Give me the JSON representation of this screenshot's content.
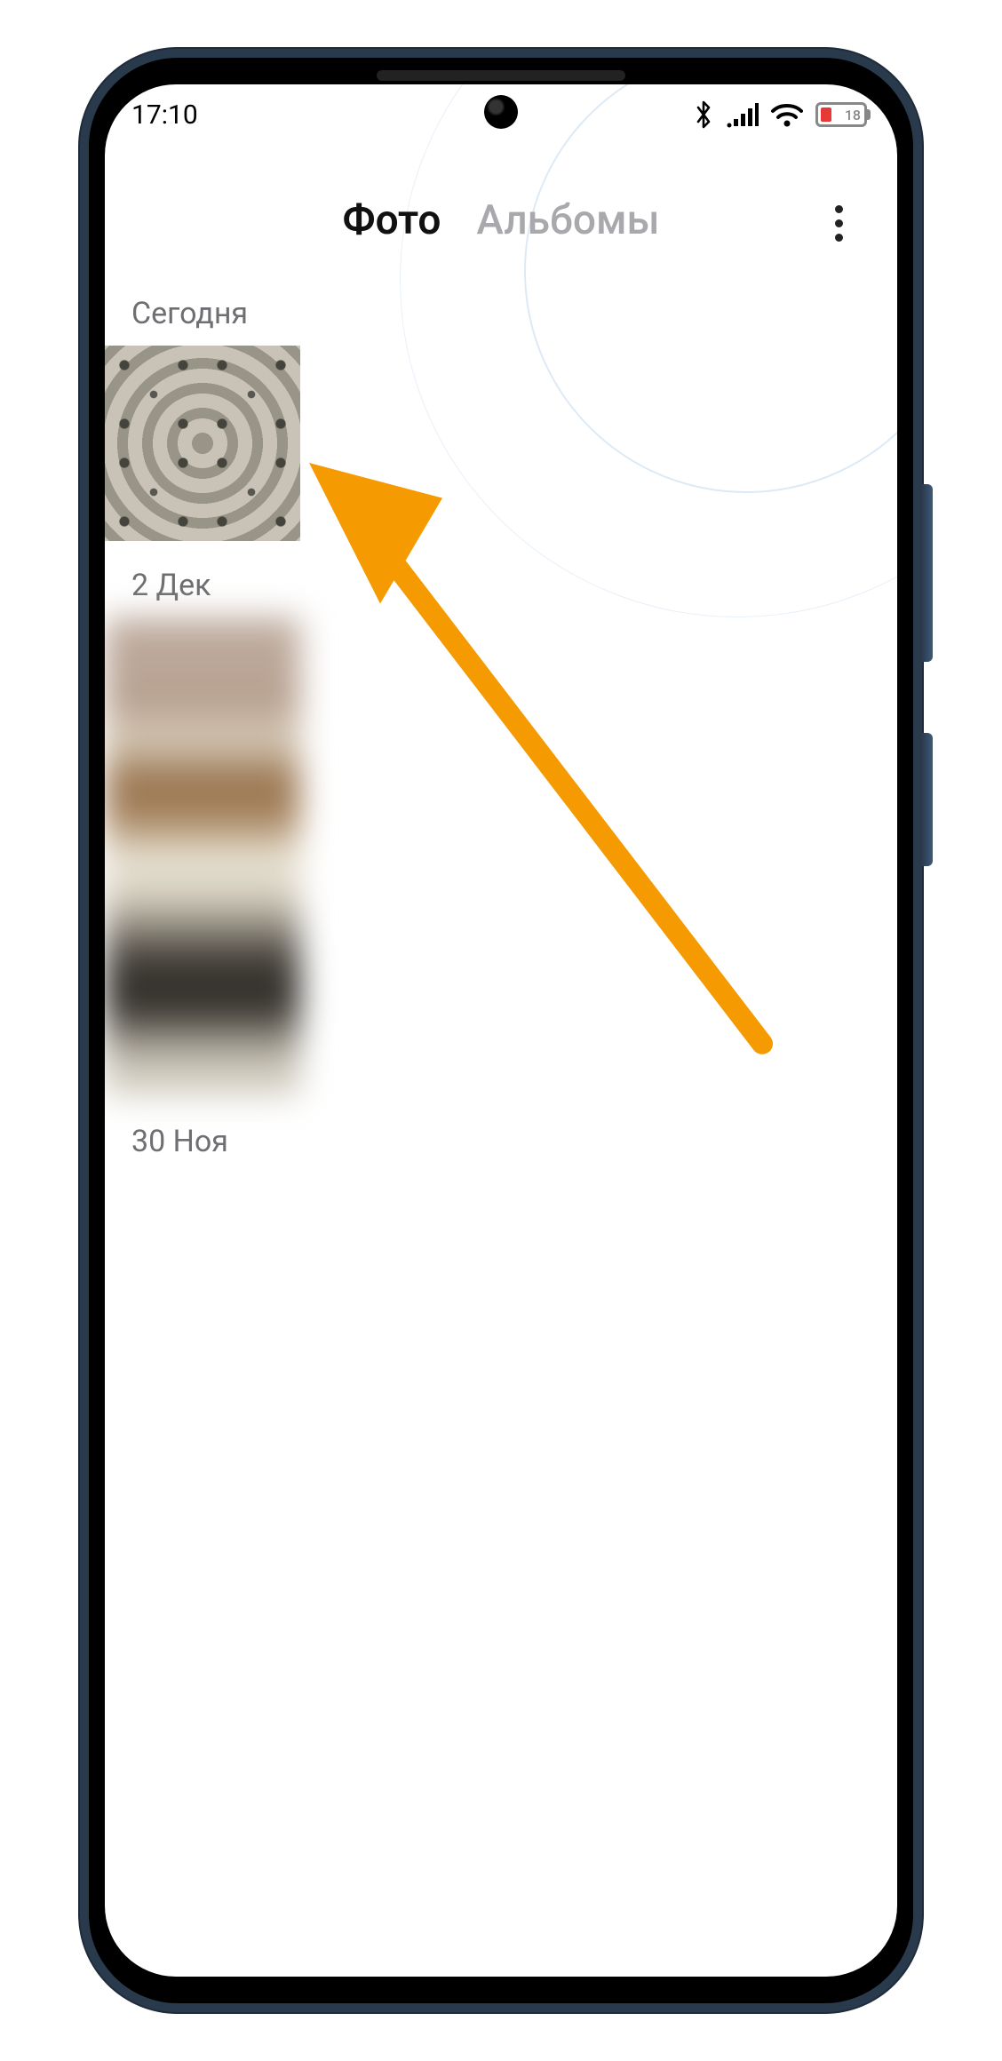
{
  "statusbar": {
    "time": "17:10",
    "battery_pct": "18"
  },
  "tabs": {
    "photos": "Фото",
    "albums": "Альбомы"
  },
  "sections": {
    "today": "Сегодня",
    "dec2": "2 Дек",
    "nov30": "30 Ноя"
  },
  "annotation": {
    "arrow_color": "#F59A00"
  }
}
